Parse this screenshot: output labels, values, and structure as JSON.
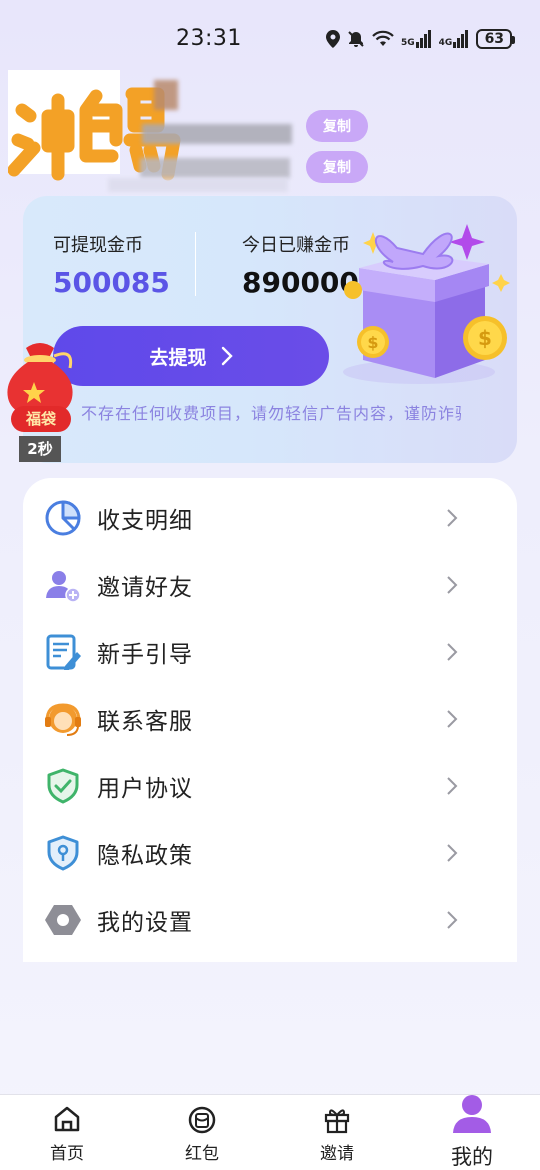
{
  "status_bar": {
    "time": "23:31",
    "network_1": "5G",
    "network_2": "4G",
    "battery": "63"
  },
  "profile": {
    "logo_text": "冲鸭",
    "copy_label_1": "复制",
    "copy_label_2": "复制"
  },
  "wallet": {
    "withdrawable_label": "可提现金币",
    "withdrawable_value": "500085",
    "today_label": "今日已赚金币",
    "today_value": "890000",
    "withdraw_button": "去提现",
    "notice": "不存在任何收费项目，请勿轻信广告内容，谨防诈骗"
  },
  "lucky_bag": {
    "label": "福袋",
    "timer": "2秒"
  },
  "menu": {
    "items": [
      {
        "label": "收支明细",
        "icon": "pie-chart-icon"
      },
      {
        "label": "邀请好友",
        "icon": "add-user-icon"
      },
      {
        "label": "新手引导",
        "icon": "guide-document-icon"
      },
      {
        "label": "联系客服",
        "icon": "headset-icon"
      },
      {
        "label": "用户协议",
        "icon": "shield-check-icon"
      },
      {
        "label": "隐私政策",
        "icon": "privacy-shield-icon"
      },
      {
        "label": "我的设置",
        "icon": "settings-hexagon-icon"
      }
    ]
  },
  "bottom_nav": {
    "items": [
      {
        "label": "首页",
        "icon": "home-icon"
      },
      {
        "label": "红包",
        "icon": "red-packet-icon"
      },
      {
        "label": "邀请",
        "icon": "gift-icon"
      },
      {
        "label": "我的",
        "icon": "user-icon",
        "active": true
      }
    ]
  },
  "colors": {
    "accent": "#5f49ea",
    "balance": "#5b55e6",
    "copy_button": "#c9a8f7",
    "active_tab": "#a35ce6"
  }
}
